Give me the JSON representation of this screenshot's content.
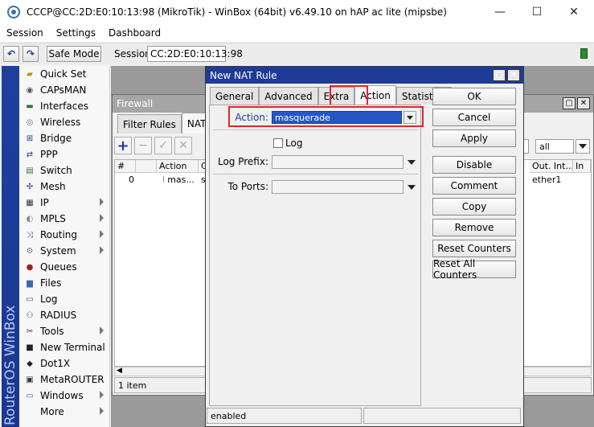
{
  "window": {
    "title": "CCCP@CC:2D:E0:10:13:98 (MikroTik) - WinBox (64bit) v6.49.10 on hAP ac lite (mipsbe)",
    "minimize": "—",
    "maximize": "☐",
    "close": "✕"
  },
  "menu": [
    "Session",
    "Settings",
    "Dashboard"
  ],
  "toolbar": {
    "undo": "↶",
    "redo": "↷",
    "safe_mode": "Safe Mode",
    "session_label": "Session:",
    "session_value": "CC:2D:E0:10:13:98"
  },
  "sidebar": {
    "brand": "RouterOS WinBox",
    "items": [
      {
        "label": "Quick Set",
        "icon": "quick-set-icon",
        "submenu": false
      },
      {
        "label": "CAPsMAN",
        "icon": "capsman-icon",
        "submenu": false
      },
      {
        "label": "Interfaces",
        "icon": "interfaces-icon",
        "submenu": false
      },
      {
        "label": "Wireless",
        "icon": "wireless-icon",
        "submenu": false
      },
      {
        "label": "Bridge",
        "icon": "bridge-icon",
        "submenu": false
      },
      {
        "label": "PPP",
        "icon": "ppp-icon",
        "submenu": false
      },
      {
        "label": "Switch",
        "icon": "switch-icon",
        "submenu": false
      },
      {
        "label": "Mesh",
        "icon": "mesh-icon",
        "submenu": false
      },
      {
        "label": "IP",
        "icon": "ip-icon",
        "submenu": true
      },
      {
        "label": "MPLS",
        "icon": "mpls-icon",
        "submenu": true
      },
      {
        "label": "Routing",
        "icon": "routing-icon",
        "submenu": true
      },
      {
        "label": "System",
        "icon": "system-icon",
        "submenu": true
      },
      {
        "label": "Queues",
        "icon": "queues-icon",
        "submenu": false
      },
      {
        "label": "Files",
        "icon": "files-icon",
        "submenu": false
      },
      {
        "label": "Log",
        "icon": "log-icon",
        "submenu": false
      },
      {
        "label": "RADIUS",
        "icon": "radius-icon",
        "submenu": false
      },
      {
        "label": "Tools",
        "icon": "tools-icon",
        "submenu": true
      },
      {
        "label": "New Terminal",
        "icon": "terminal-icon",
        "submenu": false
      },
      {
        "label": "Dot1X",
        "icon": "dot1x-icon",
        "submenu": false
      },
      {
        "label": "MetaROUTER",
        "icon": "metarouter-icon",
        "submenu": false
      },
      {
        "label": "Windows",
        "icon": "windows-icon",
        "submenu": true
      },
      {
        "label": "More",
        "icon": "",
        "submenu": true
      }
    ]
  },
  "firewall": {
    "title": "Firewall",
    "tabs": [
      "Filter Rules",
      "NAT",
      "M"
    ],
    "active_tab": "NAT",
    "filter_value": "all",
    "columns": [
      "#",
      "Action",
      "Ch",
      "Out. Int...",
      "In"
    ],
    "rows": [
      {
        "num": "0",
        "action": "mas...",
        "chain": "sr",
        "out_interface": "ether1"
      }
    ],
    "status": "1 item"
  },
  "nat_rule": {
    "title": "New NAT Rule",
    "tabs": [
      "General",
      "Advanced",
      "Extra",
      "Action",
      "Statistics"
    ],
    "active_tab": "Action",
    "fields": {
      "action_label": "Action:",
      "action_value": "masquerade",
      "log_label": "Log",
      "log_prefix_label": "Log Prefix:",
      "to_ports_label": "To Ports:"
    },
    "buttons": [
      "OK",
      "Cancel",
      "Apply",
      "Disable",
      "Comment",
      "Copy",
      "Remove",
      "Reset Counters",
      "Reset All Counters"
    ],
    "status": "enabled",
    "highlight_color": "#e0262c"
  }
}
